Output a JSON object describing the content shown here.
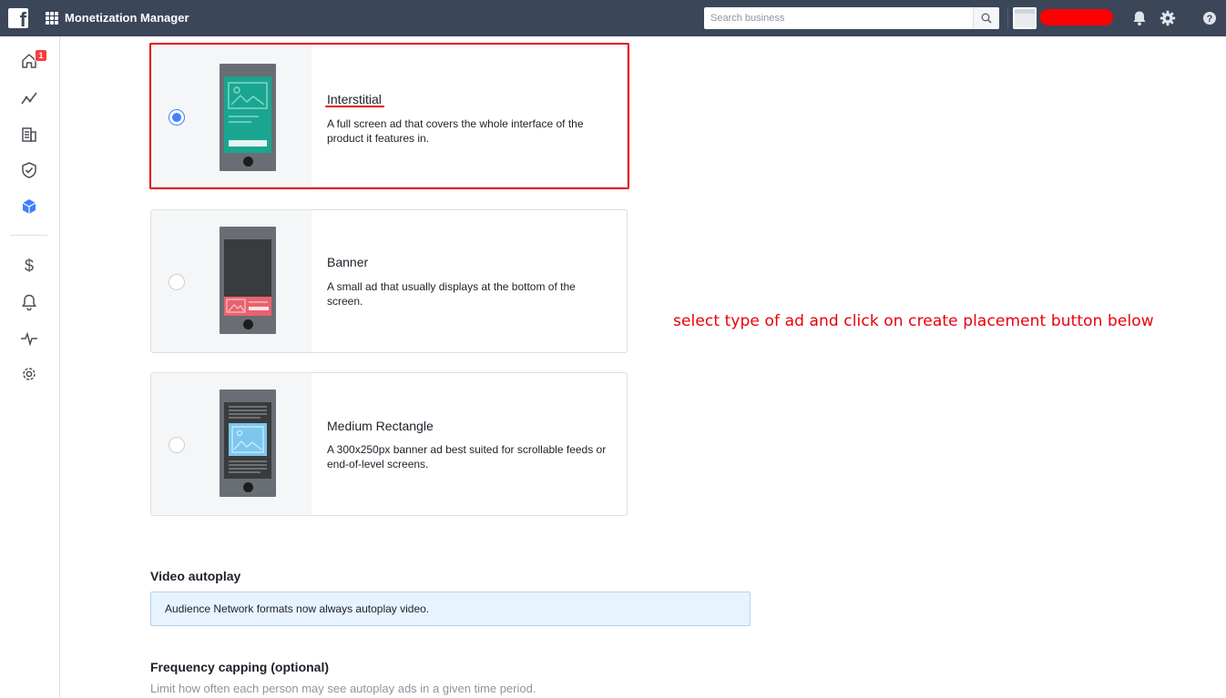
{
  "header": {
    "app_title": "Monetization Manager",
    "search_placeholder": "Search business",
    "logo_letter": "f",
    "colors": {
      "bar": "#3b4659",
      "redaction": "#ff0000"
    }
  },
  "sidebar": {
    "items": [
      {
        "name": "home-icon",
        "badge": "1"
      },
      {
        "name": "performance-icon"
      },
      {
        "name": "properties-icon"
      },
      {
        "name": "integrity-icon"
      },
      {
        "name": "placements-icon",
        "active": true
      },
      {
        "name": "payouts-icon",
        "glyph": "$"
      },
      {
        "name": "notifications-icon"
      },
      {
        "name": "activity-icon"
      },
      {
        "name": "settings-icon"
      }
    ]
  },
  "formats": [
    {
      "title": "Interstitial",
      "description": "A full screen ad that covers the whole interface of the product it features in.",
      "selected": true
    },
    {
      "title": "Banner",
      "description": "A small ad that usually displays at the bottom of the screen.",
      "selected": false
    },
    {
      "title": "Medium Rectangle",
      "description": "A 300x250px banner ad best suited for scrollable feeds or end-of-level screens.",
      "selected": false
    }
  ],
  "annotation": "select type of ad and click on create placement button below",
  "video_autoplay": {
    "title": "Video autoplay",
    "info": "Audience Network formats now always autoplay video."
  },
  "frequency_capping": {
    "title": "Frequency capping (optional)",
    "subtitle": "Limit how often each person may see autoplay ads in a given time period."
  }
}
